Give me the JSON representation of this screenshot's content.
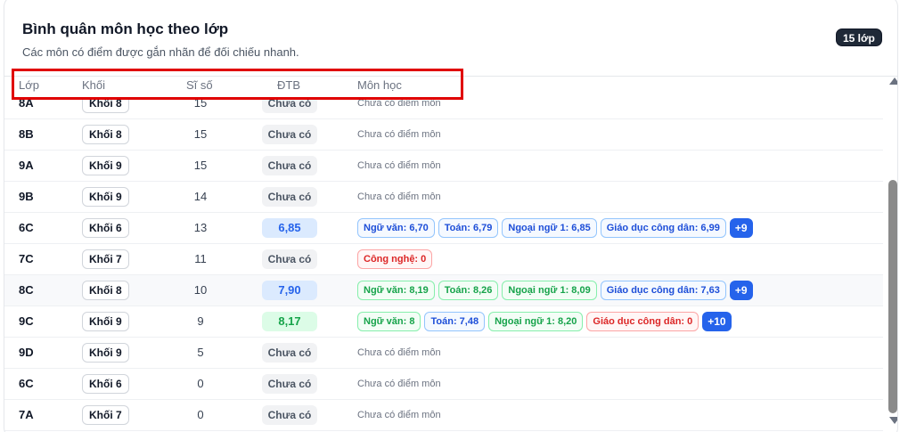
{
  "header": {
    "title": "Bình quân môn học theo lớp",
    "subtitle": "Các môn có điểm được gắn nhãn để đối chiếu nhanh.",
    "count_badge": "15 lớp"
  },
  "columns": {
    "class": "Lớp",
    "grade": "Khối",
    "size": "Sĩ số",
    "avg": "ĐTB",
    "subjects": "Môn học"
  },
  "rows": [
    {
      "class": "8A",
      "grade": "Khối 8",
      "size": "15",
      "avg": "Chưa có",
      "avg_style": "none",
      "subjects": [],
      "no_score": "Chưa có điểm môn"
    },
    {
      "class": "8B",
      "grade": "Khối 8",
      "size": "15",
      "avg": "Chưa có",
      "avg_style": "none",
      "subjects": [],
      "no_score": "Chưa có điểm môn"
    },
    {
      "class": "9A",
      "grade": "Khối 9",
      "size": "15",
      "avg": "Chưa có",
      "avg_style": "none",
      "subjects": [],
      "no_score": "Chưa có điểm môn"
    },
    {
      "class": "9B",
      "grade": "Khối 9",
      "size": "14",
      "avg": "Chưa có",
      "avg_style": "none",
      "subjects": [],
      "no_score": "Chưa có điểm môn"
    },
    {
      "class": "6C",
      "grade": "Khối 6",
      "size": "13",
      "avg": "6,85",
      "avg_style": "blue",
      "subjects": [
        {
          "label": "Ngữ văn: 6,70",
          "color": "blue"
        },
        {
          "label": "Toán: 6,79",
          "color": "blue"
        },
        {
          "label": "Ngoại ngữ 1: 6,85",
          "color": "blue"
        },
        {
          "label": "Giáo dục công dân: 6,99",
          "color": "blue"
        }
      ],
      "more": "+9"
    },
    {
      "class": "7C",
      "grade": "Khối 7",
      "size": "11",
      "avg": "Chưa có",
      "avg_style": "none",
      "subjects": [
        {
          "label": "Công nghệ: 0",
          "color": "red"
        }
      ]
    },
    {
      "class": "8C",
      "grade": "Khối 8",
      "size": "10",
      "avg": "7,90",
      "avg_style": "blue",
      "highlight": true,
      "subjects": [
        {
          "label": "Ngữ văn: 8,19",
          "color": "green"
        },
        {
          "label": "Toán: 8,26",
          "color": "green"
        },
        {
          "label": "Ngoại ngữ 1: 8,09",
          "color": "green"
        },
        {
          "label": "Giáo dục công dân: 7,63",
          "color": "blue"
        }
      ],
      "more": "+9"
    },
    {
      "class": "9C",
      "grade": "Khối 9",
      "size": "9",
      "avg": "8,17",
      "avg_style": "green",
      "subjects": [
        {
          "label": "Ngữ văn: 8",
          "color": "green"
        },
        {
          "label": "Toán: 7,48",
          "color": "blue"
        },
        {
          "label": "Ngoại ngữ 1: 8,20",
          "color": "green"
        },
        {
          "label": "Giáo dục công dân: 0",
          "color": "red"
        }
      ],
      "more": "+10"
    },
    {
      "class": "9D",
      "grade": "Khối 9",
      "size": "5",
      "avg": "Chưa có",
      "avg_style": "none",
      "subjects": [],
      "no_score": "Chưa có điểm môn"
    },
    {
      "class": "6C",
      "grade": "Khối 6",
      "size": "0",
      "avg": "Chưa có",
      "avg_style": "none",
      "subjects": [],
      "no_score": "Chưa có điểm môn"
    },
    {
      "class": "7A",
      "grade": "Khối 7",
      "size": "0",
      "avg": "Chưa có",
      "avg_style": "none",
      "subjects": [],
      "no_score": "Chưa có điểm môn"
    }
  ],
  "colors": {
    "accent": "#2563eb",
    "good": "#16a34a",
    "bad": "#dc2626",
    "annotation": "#e00000"
  }
}
